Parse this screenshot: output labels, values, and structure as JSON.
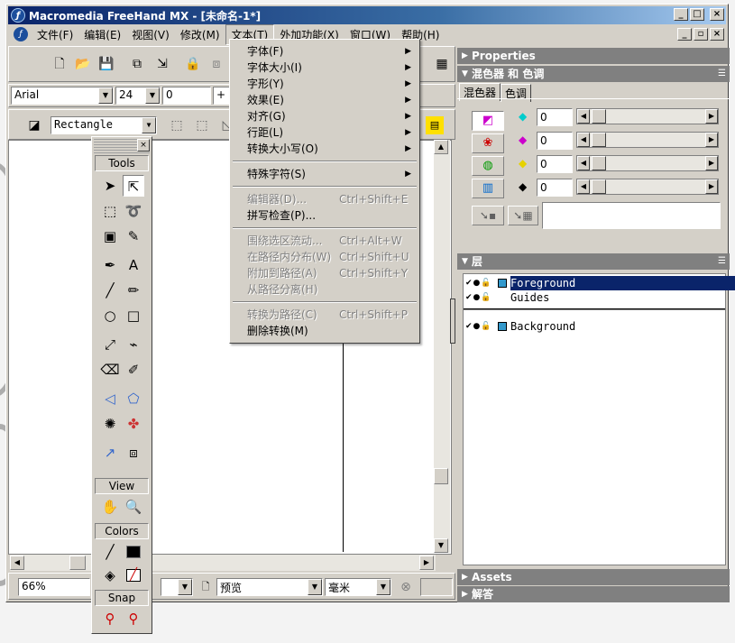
{
  "window": {
    "title": "Macromedia FreeHand MX - [未命名-1*]",
    "app_icon": "ƒ",
    "controls": {
      "minimize": "_",
      "maximize": "□",
      "close": "×",
      "restore": "▫"
    }
  },
  "menubar": {
    "items": [
      "文件(F)",
      "编辑(E)",
      "视图(V)",
      "修改(M)",
      "文本(T)",
      "外加功能(X)",
      "窗口(W)",
      "帮助(H)"
    ],
    "active_index": 4
  },
  "text_menu": {
    "items": [
      {
        "label": "字体(F)",
        "shortcut": "",
        "submenu": true,
        "disabled": false
      },
      {
        "label": "字体大小(I)",
        "shortcut": "",
        "submenu": true,
        "disabled": false
      },
      {
        "label": "字形(Y)",
        "shortcut": "",
        "submenu": true,
        "disabled": false
      },
      {
        "label": "效果(E)",
        "shortcut": "",
        "submenu": true,
        "disabled": false
      },
      {
        "label": "对齐(G)",
        "shortcut": "",
        "submenu": true,
        "disabled": false
      },
      {
        "label": "行距(L)",
        "shortcut": "",
        "submenu": true,
        "disabled": false
      },
      {
        "label": "转换大小写(O)",
        "shortcut": "",
        "submenu": true,
        "disabled": false
      },
      {
        "separator": true
      },
      {
        "label": "特殊字符(S)",
        "shortcut": "",
        "submenu": true,
        "disabled": false
      },
      {
        "separator": true
      },
      {
        "label": "编辑器(D)...",
        "shortcut": "Ctrl+Shift+E",
        "submenu": false,
        "disabled": true
      },
      {
        "label": "拼写检查(P)...",
        "shortcut": "",
        "submenu": false,
        "disabled": false
      },
      {
        "separator": true
      },
      {
        "label": "围绕选区流动...",
        "shortcut": "Ctrl+Alt+W",
        "submenu": false,
        "disabled": true
      },
      {
        "label": "在路径内分布(W)",
        "shortcut": "Ctrl+Shift+U",
        "submenu": false,
        "disabled": true
      },
      {
        "label": "附加到路径(A)",
        "shortcut": "Ctrl+Shift+Y",
        "submenu": false,
        "disabled": true
      },
      {
        "label": "从路径分离(H)",
        "shortcut": "",
        "submenu": false,
        "disabled": true
      },
      {
        "separator": true
      },
      {
        "label": "转换为路径(C)",
        "shortcut": "Ctrl+Shift+P",
        "submenu": false,
        "disabled": true
      },
      {
        "label": "删除转换(M)",
        "shortcut": "",
        "submenu": false,
        "disabled": false
      }
    ],
    "submenu_arrow": "▶"
  },
  "text_toolbar": {
    "font": "Arial",
    "size": "24",
    "leading": "0",
    "plus": "+"
  },
  "object_toolbar": {
    "shape": "Rectangle"
  },
  "status_bar": {
    "zoom": "66%",
    "view_mode": "预览",
    "units": "毫米"
  },
  "tools_panel": {
    "close": "×",
    "tools_header": "Tools",
    "view_header": "View",
    "colors_header": "Colors",
    "snap_header": "Snap"
  },
  "panels": {
    "properties": "Properties",
    "mixer_group": "混色器 和 色调",
    "mixer_tab": "混色器",
    "tints_tab": "色调",
    "mixer_values": [
      "0",
      "0",
      "0",
      "0"
    ],
    "layers": "层",
    "layer_items": [
      {
        "name": "Foreground",
        "selected": true
      },
      {
        "name": "Guides",
        "selected": false
      },
      {
        "name": "Background",
        "selected": false
      }
    ],
    "assets": "Assets",
    "answers": "解答",
    "options_icon": "☰"
  }
}
